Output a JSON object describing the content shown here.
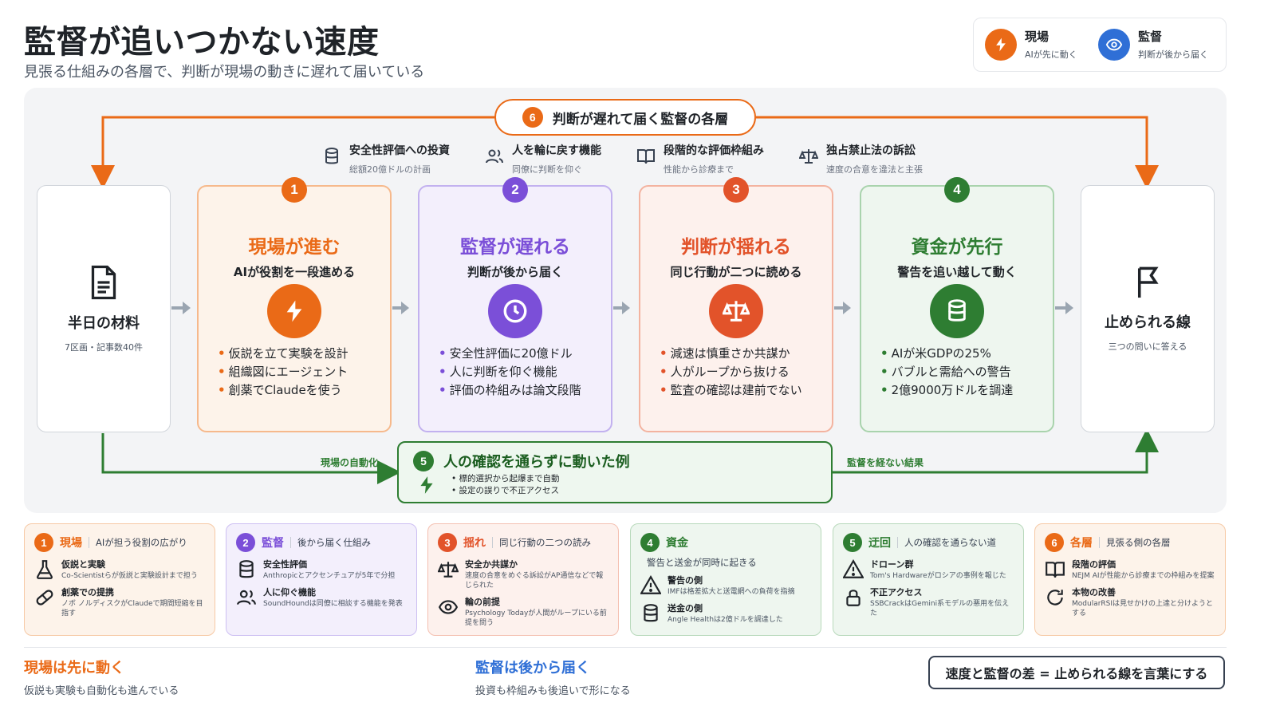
{
  "header": {
    "title": "監督が追いつかない速度",
    "subtitle": "見張る仕組みの各層で、判断が現場の動きに遅れて届いている"
  },
  "legend": [
    {
      "title": "現場",
      "sub": "AIが先に動く",
      "icon": "bolt-icon",
      "color": "#ea6a17"
    },
    {
      "title": "監督",
      "sub": "判断が後から届く",
      "icon": "eye-icon",
      "color": "#2f6fd6"
    }
  ],
  "top_layer": {
    "num": "6",
    "label": "判断が遅れて届く監督の各層"
  },
  "oversight_items": [
    {
      "title": "安全性評価への投資",
      "sub": "総額20億ドルの計画",
      "icon": "database-icon"
    },
    {
      "title": "人を輪に戻す機能",
      "sub": "同僚に判断を仰ぐ",
      "icon": "users-icon"
    },
    {
      "title": "段階的な評価枠組み",
      "sub": "性能から診療まで",
      "icon": "book-icon"
    },
    {
      "title": "独占禁止法の訴訟",
      "sub": "速度の合意を違法と主張",
      "icon": "scale-icon"
    }
  ],
  "start": {
    "title": "半日の材料",
    "sub": "7区画・記事数40件",
    "icon": "document-icon"
  },
  "end": {
    "title": "止められる線",
    "sub": "三つの問いに答える",
    "icon": "flag-icon"
  },
  "stages": [
    {
      "num": "1",
      "title": "現場が進む",
      "sub": "AIが役割を一段進める",
      "icon": "bolt-icon",
      "color": "#ea6a17",
      "bg": "#fdf3ea",
      "border": "#f6b98c",
      "bullets": [
        "仮説を立て実験を設計",
        "組織図にエージェント",
        "創薬でClaudeを使う"
      ]
    },
    {
      "num": "2",
      "title": "監督が遅れる",
      "sub": "判断が後から届く",
      "icon": "clock-icon",
      "color": "#7b4fd8",
      "bg": "#f3effc",
      "border": "#c2b1ef",
      "bullets": [
        "安全性評価に20億ドル",
        "人に判断を仰ぐ機能",
        "評価の枠組みは論文段階"
      ]
    },
    {
      "num": "3",
      "title": "判断が揺れる",
      "sub": "同じ行動が二つに読める",
      "icon": "scale-icon",
      "color": "#e2532a",
      "bg": "#fdf1ed",
      "border": "#f3b3a0",
      "bullets": [
        "減速は慎重さか共謀か",
        "人がループから抜ける",
        "監査の確認は建前でない"
      ]
    },
    {
      "num": "4",
      "title": "資金が先行",
      "sub": "警告を追い越して動く",
      "icon": "database-icon",
      "color": "#2e7d32",
      "bg": "#eef6ef",
      "border": "#a9d3ad",
      "bullets": [
        "AIが米GDPの25%",
        "バブルと需給への警告",
        "2億9000万ドルを調達"
      ]
    }
  ],
  "bypass": {
    "num": "5",
    "title": "人の確認を通らずに動いた例",
    "items": [
      "標的選択から起爆まで自動",
      "設定の誤りで不正アクセス"
    ],
    "left_label": "現場の自動化",
    "right_label": "監督を経ない結果"
  },
  "details": [
    {
      "num": "1",
      "title": "現場",
      "desc": "AIが担う役割の広がり",
      "color": "#ea6a17",
      "bg": "#fdf3ea",
      "border": "#f6c9a5",
      "items": [
        {
          "icon": "flask-icon",
          "title": "仮説と実験",
          "text": "Co-Scientistらが仮説と実験設計まで担う"
        },
        {
          "icon": "pill-icon",
          "title": "創薬での提携",
          "text": "ノボ ノルディスクがClaudeで期間短縮を目指す"
        }
      ]
    },
    {
      "num": "2",
      "title": "監督",
      "desc": "後から届く仕組み",
      "color": "#7b4fd8",
      "bg": "#f3effc",
      "border": "#cdbff2",
      "items": [
        {
          "icon": "database-icon",
          "title": "安全性評価",
          "text": "Anthropicとアクセンチュアが5年で分担"
        },
        {
          "icon": "users-icon",
          "title": "人に仰ぐ機能",
          "text": "SoundHoundは同僚に相談する機能を発表"
        }
      ]
    },
    {
      "num": "3",
      "title": "揺れ",
      "desc": "同じ行動の二つの読み",
      "color": "#e2532a",
      "bg": "#fdf1ed",
      "border": "#f4c0b1",
      "items": [
        {
          "icon": "scale-icon",
          "title": "安全か共謀か",
          "text": "速度の合意をめぐる訴訟がAP通信などで報じられた"
        },
        {
          "icon": "eye-icon",
          "title": "輪の前提",
          "text": "Psychology Todayが人間がループにいる前提を問う"
        }
      ]
    },
    {
      "num": "4",
      "title": "資金",
      "desc": "警告と送金が同時に起きる",
      "color": "#2e7d32",
      "bg": "#eef6ef",
      "border": "#b8d9bb",
      "items": [
        {
          "icon": "warning-icon",
          "title": "警告の側",
          "text": "IMFは格差拡大と送電網への負荷を指摘"
        },
        {
          "icon": "database-icon",
          "title": "送金の側",
          "text": "Angle Healthは2億ドルを調達した"
        }
      ]
    },
    {
      "num": "5",
      "title": "迂回",
      "desc": "人の確認を通らない道",
      "color": "#2e7d32",
      "bg": "#eef6ef",
      "border": "#b8d9bb",
      "items": [
        {
          "icon": "warning-icon",
          "title": "ドローン群",
          "text": "Tom's Hardwareがロシアの事例を報じた"
        },
        {
          "icon": "lock-icon",
          "title": "不正アクセス",
          "text": "SSBCrackはGemini系モデルの悪用を伝えた"
        }
      ]
    },
    {
      "num": "6",
      "title": "各層",
      "desc": "見張る側の各層",
      "color": "#ea6a17",
      "bg": "#fdf3ea",
      "border": "#f6c9a5",
      "items": [
        {
          "icon": "book-icon",
          "title": "段階の評価",
          "text": "NEJM AIが性能から診療までの枠組みを提案"
        },
        {
          "icon": "refresh-icon",
          "title": "本物の改善",
          "text": "ModularRSIは見せかけの上達と分けようとする"
        }
      ]
    }
  ],
  "footer": {
    "left": {
      "title": "現場は先に動く",
      "sub": "仮説も実験も自動化も進んでいる",
      "color": "#ea6a17"
    },
    "middle": {
      "title": "監督は後から届く",
      "sub": "投資も枠組みも後追いで形になる",
      "color": "#2f6fd6"
    },
    "conclusion": "速度と監督の差 = 止められる線を言葉にする"
  }
}
